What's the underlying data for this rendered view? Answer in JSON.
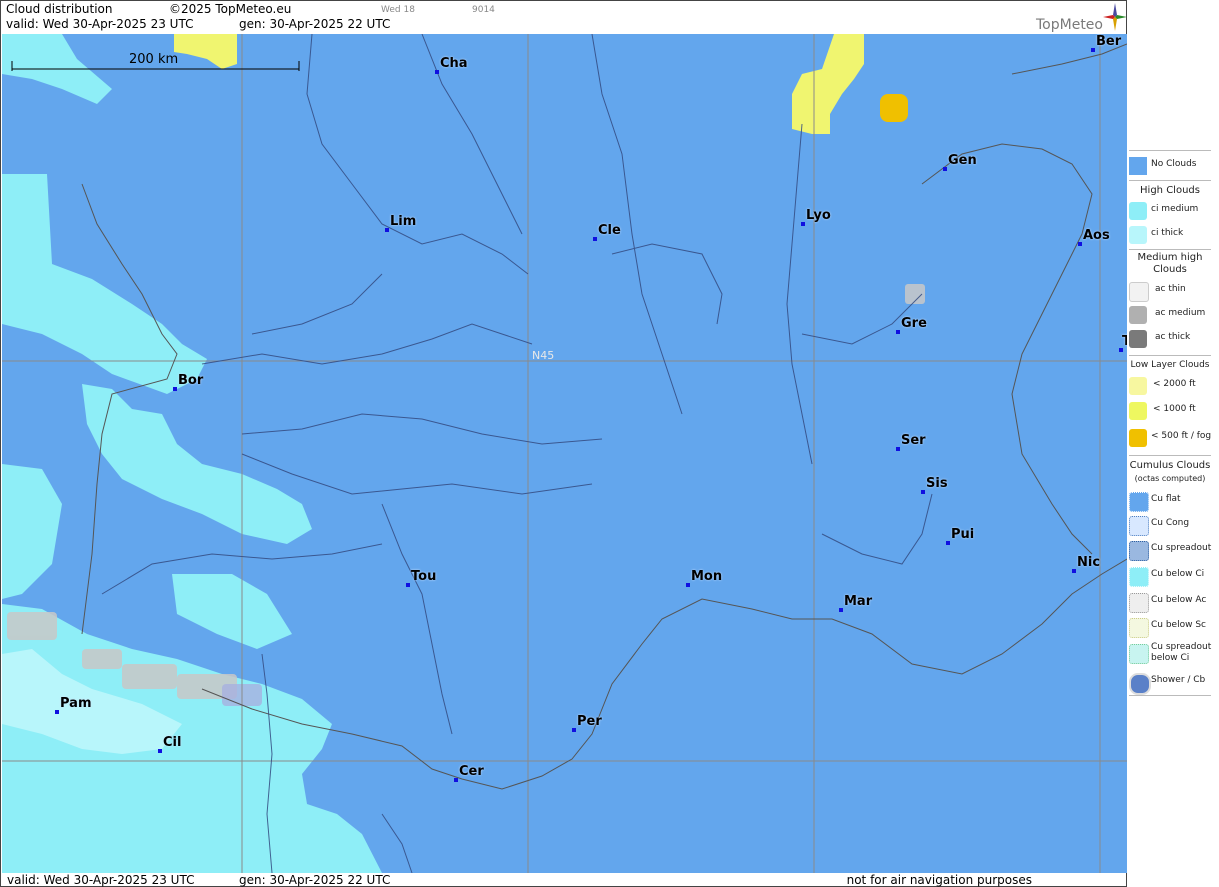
{
  "header": {
    "title": "Cloud distribution",
    "copyright": "©2025 TopMeteo.eu",
    "valid": "valid:  Wed  30-Apr-2025  23 UTC",
    "generated": "gen: 30-Apr-2025 22 UTC",
    "small_code_1": "Wed 18",
    "small_code_2": "9014",
    "logo": "TopMeteo"
  },
  "map": {
    "scale_label": "200 km",
    "lat_label": "N45",
    "cities": [
      {
        "name": "Cha"
      },
      {
        "name": "Ber"
      },
      {
        "name": "Gen"
      },
      {
        "name": "Lim"
      },
      {
        "name": "Cle"
      },
      {
        "name": "Lyo"
      },
      {
        "name": "Aos"
      },
      {
        "name": "Gre"
      },
      {
        "name": "Bor"
      },
      {
        "name": "Ser"
      },
      {
        "name": "Sis"
      },
      {
        "name": "Pui"
      },
      {
        "name": "Tou"
      },
      {
        "name": "Mon"
      },
      {
        "name": "Nic"
      },
      {
        "name": "Mar"
      },
      {
        "name": "Pam"
      },
      {
        "name": "Cil"
      },
      {
        "name": "Per"
      },
      {
        "name": "Cer"
      },
      {
        "name": "T"
      }
    ],
    "colors": {
      "no_clouds": "#63a6ed",
      "ci_medium": "#8eeef7",
      "ci_thick": "#b8f6fb",
      "low_2000": "#f7f7a0",
      "low_1000": "#eef760",
      "low_500": "#f0c000"
    }
  },
  "legend": {
    "no_clouds": "No Clouds",
    "high_clouds": "High Clouds",
    "ci_medium": "ci medium",
    "ci_thick": "ci thick",
    "medium_high": "Medium high Clouds",
    "ac_thin": "ac thin",
    "ac_medium": "ac medium",
    "ac_thick": "ac thick",
    "low_layer": "Low Layer Clouds",
    "low_2000": "< 2000 ft",
    "low_1000": "< 1000 ft",
    "low_500": "< 500 ft / fog",
    "cumulus": "Cumulus Clouds",
    "cumulus_sub": "(octas computed)",
    "cu_flat": "Cu flat",
    "cu_cong": "Cu Cong",
    "cu_spreadout": "Cu spreadout",
    "cu_below_ci": "Cu below Ci",
    "cu_below_ac": "Cu below Ac",
    "cu_below_sc": "Cu below Sc",
    "cu_spreadout_below_ci": "Cu spreadout below Ci",
    "shower_cb": "Shower / Cb"
  },
  "footer": {
    "valid": "valid:  Wed  30-Apr-2025  23 UTC",
    "generated": "gen: 30-Apr-2025 22 UTC",
    "disclaimer": "not for air navigation purposes"
  }
}
